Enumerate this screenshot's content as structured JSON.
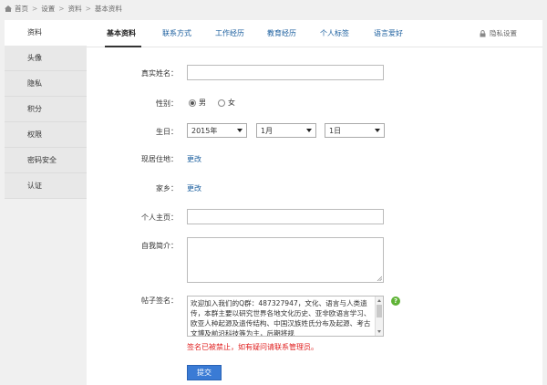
{
  "breadcrumb": [
    "首页",
    "设置",
    "资料",
    "基本资料"
  ],
  "sidebar": [
    {
      "label": "资料",
      "active": true
    },
    {
      "label": "头像"
    },
    {
      "label": "隐私"
    },
    {
      "label": "积分"
    },
    {
      "label": "权限"
    },
    {
      "label": "密码安全"
    },
    {
      "label": "认证"
    }
  ],
  "tabs": [
    {
      "label": "基本资料",
      "active": true
    },
    {
      "label": "联系方式"
    },
    {
      "label": "工作经历"
    },
    {
      "label": "教育经历"
    },
    {
      "label": "个人标签"
    },
    {
      "label": "语言爱好"
    }
  ],
  "privacy_label": "隐私设置",
  "form": {
    "real_name_label": "真实姓名：",
    "real_name_value": "",
    "gender_label": "性别：",
    "gender_male": "男",
    "gender_female": "女",
    "gender_selected": "男",
    "birthday_label": "生日：",
    "birth_year": "2015年",
    "birth_month": "1月",
    "birth_day": "1日",
    "residence_label": "现居住地：",
    "residence_link": "更改",
    "hometown_label": "家乡：",
    "hometown_link": "更改",
    "homepage_label": "个人主页：",
    "homepage_value": "",
    "intro_label": "自我简介：",
    "intro_value": "",
    "signature_label": "帖子签名：",
    "signature_value": "欢迎加入我们的Q群：487327947，文化、语言与人类遗传，本群主要以研究世界各地文化历史、亚非欧语言学习、欧亚人种起源及遗传结构、中国汉族姓氏分布及起源、考古文博及前沿科技等为主，后期将规",
    "help_icon": "?",
    "warning": "签名已被禁止，如有疑问请联系管理员。",
    "submit": "提交"
  },
  "colors": {
    "link": "#1a5e9e",
    "warning": "#e02020",
    "submit": "#3a7bd5",
    "help": "#5fb336"
  }
}
